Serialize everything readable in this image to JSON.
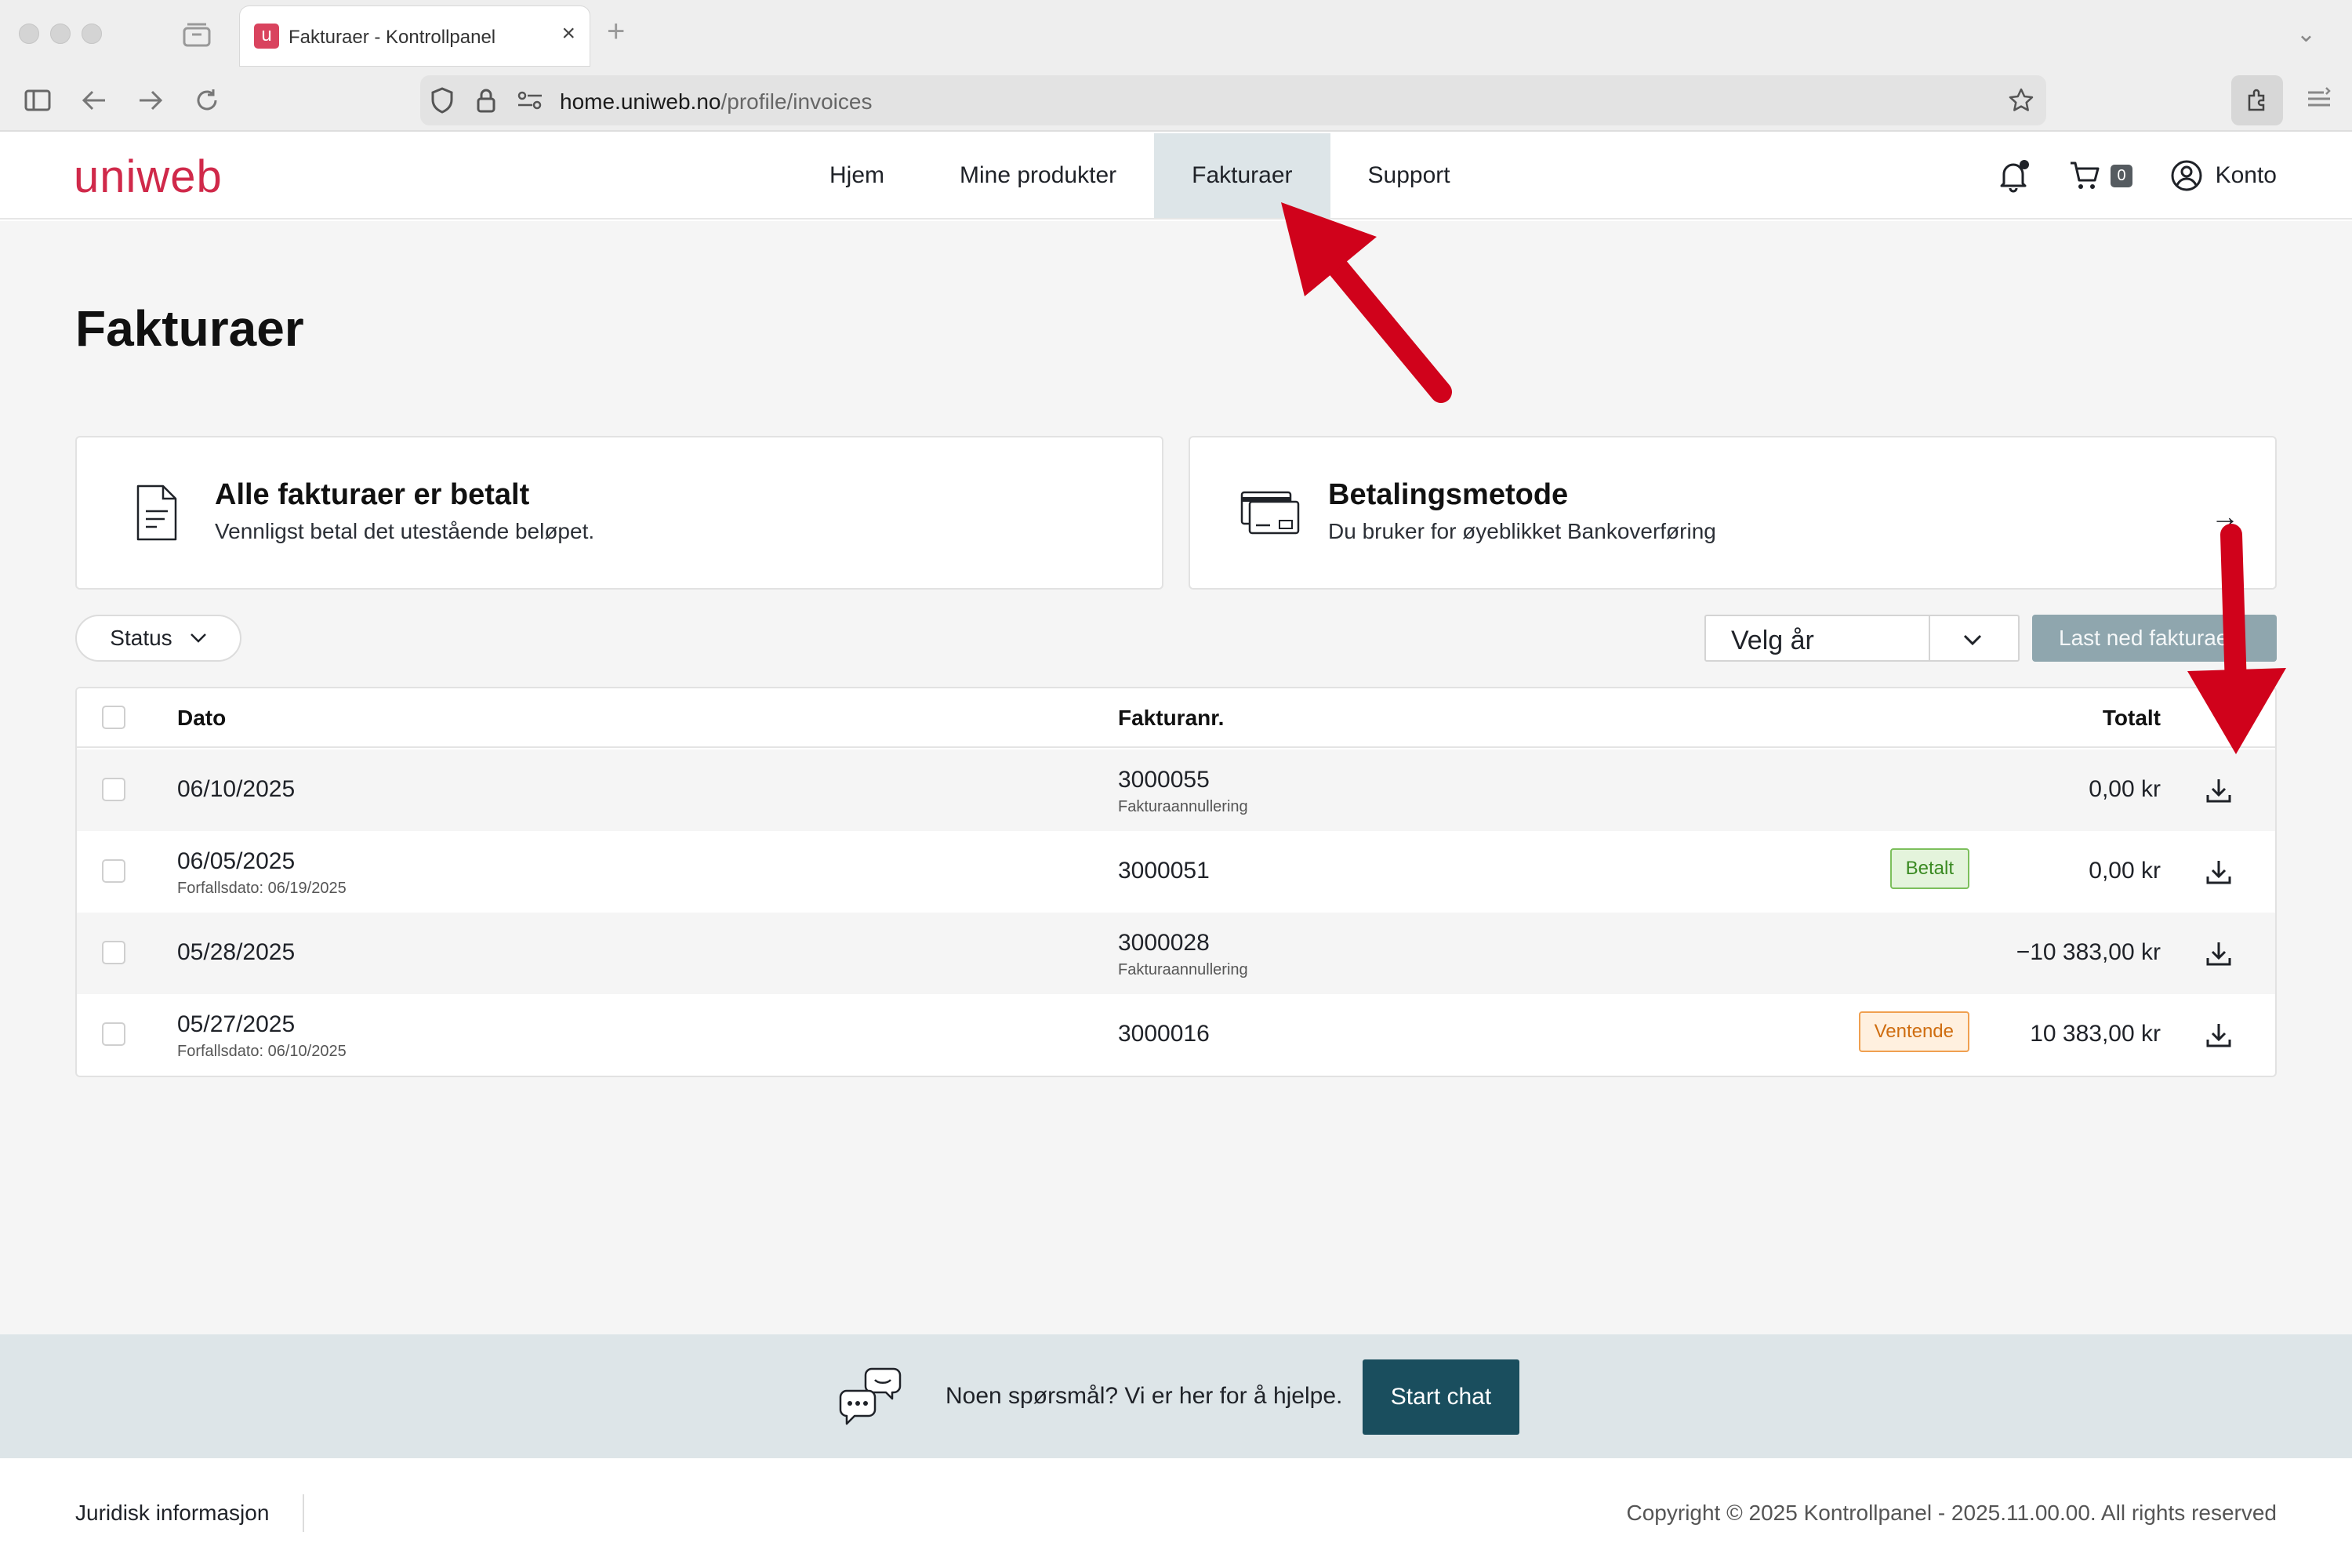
{
  "browser": {
    "tab_title": "Fakturaer - Kontrollpanel",
    "favicon_letter": "u",
    "url_host": "home.uniweb.no",
    "url_path": "/profile/invoices"
  },
  "header": {
    "logo": "uniweb",
    "nav": [
      {
        "label": "Hjem"
      },
      {
        "label": "Mine produkter"
      },
      {
        "label": "Fakturaer",
        "active": true
      },
      {
        "label": "Support"
      }
    ],
    "cart_count": "0",
    "account_label": "Konto"
  },
  "page": {
    "title": "Fakturaer",
    "cards": {
      "invoices": {
        "title": "Alle fakturaer er betalt",
        "subtitle": "Vennligst betal det utestående beløpet."
      },
      "payment": {
        "title": "Betalingsmetode",
        "subtitle": "Du bruker for øyeblikket Bankoverføring",
        "arrow": "→"
      }
    },
    "filters": {
      "status_label": "Status",
      "year_placeholder": "Velg år",
      "download_label": "Last ned fakturaer"
    },
    "table": {
      "columns": {
        "date": "Dato",
        "invoice": "Fakturanr.",
        "total": "Totalt"
      },
      "rows": [
        {
          "date": "06/10/2025",
          "date_sub": "",
          "invoice": "3000055",
          "invoice_sub": "Fakturaannullering",
          "badge": "",
          "badge_type": "",
          "total": "0,00 kr"
        },
        {
          "date": "06/05/2025",
          "date_sub": "Forfallsdato: 06/19/2025",
          "invoice": "3000051",
          "invoice_sub": "",
          "badge": "Betalt",
          "badge_type": "paid",
          "total": "0,00 kr"
        },
        {
          "date": "05/28/2025",
          "date_sub": "",
          "invoice": "3000028",
          "invoice_sub": "Fakturaannullering",
          "badge": "",
          "badge_type": "",
          "total": "−10 383,00 kr"
        },
        {
          "date": "05/27/2025",
          "date_sub": "Forfallsdato: 06/10/2025",
          "invoice": "3000016",
          "invoice_sub": "",
          "badge": "Ventende",
          "badge_type": "pending",
          "total": "10 383,00 kr"
        }
      ]
    }
  },
  "help": {
    "text": "Noen spørsmål? Vi er her for å hjelpe.",
    "button": "Start chat"
  },
  "footer": {
    "legal": "Juridisk informasjon",
    "copyright": "Copyright © 2025 Kontrollpanel - 2025.11.00.00. All rights reserved"
  },
  "colors": {
    "brand": "#d0294a",
    "active_nav": "#dde5e8",
    "chat_button": "#1a4e5e",
    "paid_badge": "#3a8a22",
    "pending_badge": "#cf6d10",
    "annotation_arrow": "#d0021b"
  }
}
